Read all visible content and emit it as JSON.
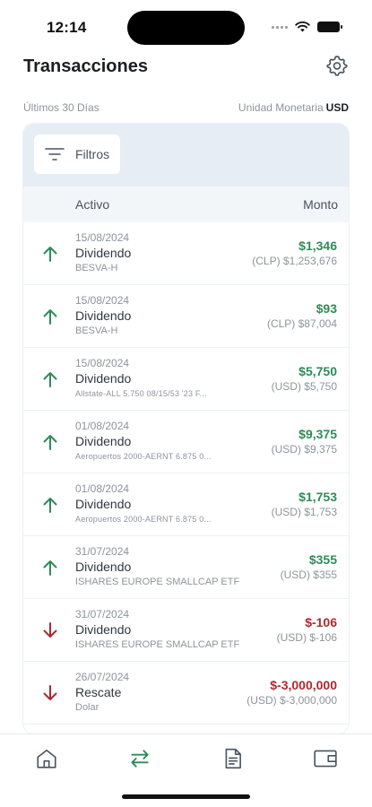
{
  "status_bar": {
    "time": "12:14"
  },
  "header": {
    "title": "Transacciones",
    "settings_icon": "gear-icon"
  },
  "meta": {
    "period": "Últimos 30 Días",
    "currency_label": "Unidad Monetaria",
    "currency_code": "USD"
  },
  "filters": {
    "label": "Filtros",
    "icon": "filter-lines-icon"
  },
  "columns": {
    "asset": "Activo",
    "amount": "Monto"
  },
  "colors": {
    "positive": "#2e8b57",
    "negative": "#b0272f",
    "accent": "#2e8b57"
  },
  "transactions": [
    {
      "direction": "up",
      "date": "15/08/2024",
      "type": "Dividendo",
      "asset": "BESVA-H",
      "amount": "$1,346",
      "local": "(CLP) $1,253,676"
    },
    {
      "direction": "up",
      "date": "15/08/2024",
      "type": "Dividendo",
      "asset": "BESVA-H",
      "amount": "$93",
      "local": "(CLP) $87,004"
    },
    {
      "direction": "up",
      "date": "15/08/2024",
      "type": "Dividendo",
      "asset": "Allstate-ALL 5.750 08/15/53 '23 F...",
      "amount": "$5,750",
      "local": "(USD) $5,750"
    },
    {
      "direction": "up",
      "date": "01/08/2024",
      "type": "Dividendo",
      "asset": "Aeropuertos 2000-AERNT 6.875 0...",
      "amount": "$9,375",
      "local": "(USD) $9,375"
    },
    {
      "direction": "up",
      "date": "01/08/2024",
      "type": "Dividendo",
      "asset": "Aeropuertos 2000-AERNT 6.875 0...",
      "amount": "$1,753",
      "local": "(USD) $1,753"
    },
    {
      "direction": "up",
      "date": "31/07/2024",
      "type": "Dividendo",
      "asset": "ISHARES EUROPE SMALLCAP ETF",
      "amount": "$355",
      "local": "(USD) $355"
    },
    {
      "direction": "down",
      "date": "31/07/2024",
      "type": "Dividendo",
      "asset": "ISHARES EUROPE SMALLCAP ETF",
      "amount": "$-106",
      "local": "(USD) $-106"
    },
    {
      "direction": "down",
      "date": "26/07/2024",
      "type": "Rescate",
      "asset": "Dolar",
      "amount": "$-3,000,000",
      "local": "(USD) $-3,000,000"
    }
  ],
  "tab_bar": {
    "items": [
      {
        "name": "home",
        "icon": "home-icon",
        "active": false
      },
      {
        "name": "transactions",
        "icon": "swap-arrows-icon",
        "active": true
      },
      {
        "name": "documents",
        "icon": "document-icon",
        "active": false
      },
      {
        "name": "wallet",
        "icon": "wallet-icon",
        "active": false
      }
    ]
  }
}
